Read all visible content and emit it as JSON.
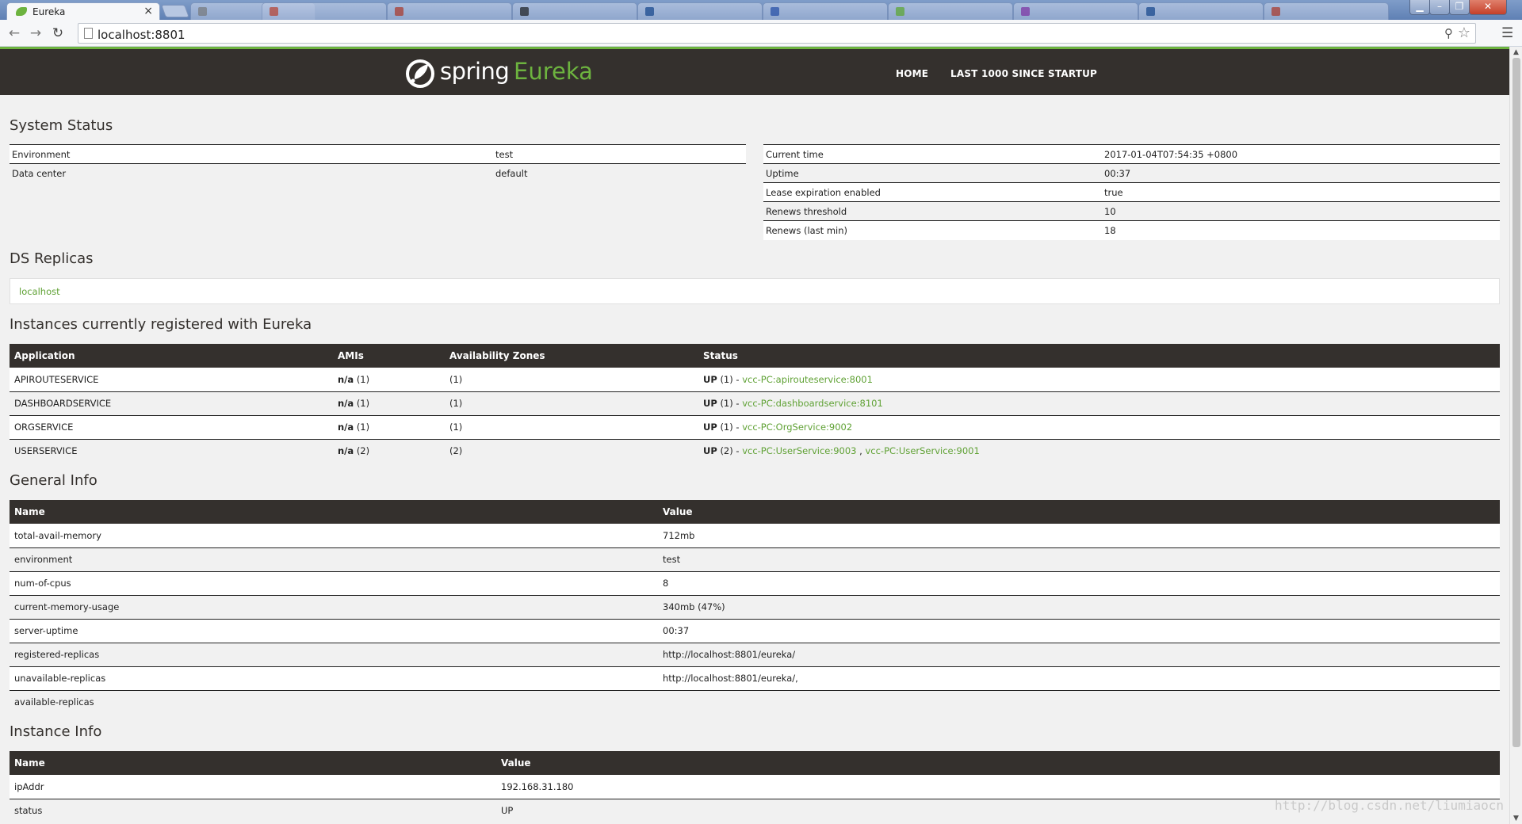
{
  "browser": {
    "tab_title": "Eureka",
    "tab_close": "×",
    "url": "localhost:8801"
  },
  "navbar": {
    "brand_spring": "spring",
    "brand_eureka": "Eureka",
    "links": [
      "HOME",
      "LAST 1000 SINCE STARTUP"
    ]
  },
  "system_status": {
    "heading": "System Status",
    "left": [
      {
        "key": "Environment",
        "value": "test"
      },
      {
        "key": "Data center",
        "value": "default"
      }
    ],
    "right": [
      {
        "key": "Current time",
        "value": "2017-01-04T07:54:35 +0800"
      },
      {
        "key": "Uptime",
        "value": "00:37"
      },
      {
        "key": "Lease expiration enabled",
        "value": "true"
      },
      {
        "key": "Renews threshold",
        "value": "10"
      },
      {
        "key": "Renews (last min)",
        "value": "18"
      }
    ]
  },
  "ds_replicas": {
    "heading": "DS Replicas",
    "replica": "localhost"
  },
  "instances": {
    "heading": "Instances currently registered with Eureka",
    "columns": [
      "Application",
      "AMIs",
      "Availability Zones",
      "Status"
    ],
    "rows": [
      {
        "application": "APIROUTESERVICE",
        "ami_label": "n/a",
        "ami_count": "(1)",
        "zones": "(1)",
        "status": "UP",
        "status_count": "(1) -",
        "links": [
          "vcc-PC:apirouteservice:8001"
        ]
      },
      {
        "application": "DASHBOARDSERVICE",
        "ami_label": "n/a",
        "ami_count": "(1)",
        "zones": "(1)",
        "status": "UP",
        "status_count": "(1) -",
        "links": [
          "vcc-PC:dashboardservice:8101"
        ]
      },
      {
        "application": "ORGSERVICE",
        "ami_label": "n/a",
        "ami_count": "(1)",
        "zones": "(1)",
        "status": "UP",
        "status_count": "(1) -",
        "links": [
          "vcc-PC:OrgService:9002"
        ]
      },
      {
        "application": "USERSERVICE",
        "ami_label": "n/a",
        "ami_count": "(2)",
        "zones": "(2)",
        "status": "UP",
        "status_count": "(2) -",
        "links": [
          "vcc-PC:UserService:9003",
          "vcc-PC:UserService:9001"
        ]
      }
    ],
    "link_separator": " , "
  },
  "general_info": {
    "heading": "General Info",
    "columns": [
      "Name",
      "Value"
    ],
    "rows": [
      {
        "name": "total-avail-memory",
        "value": "712mb"
      },
      {
        "name": "environment",
        "value": "test"
      },
      {
        "name": "num-of-cpus",
        "value": "8"
      },
      {
        "name": "current-memory-usage",
        "value": "340mb (47%)"
      },
      {
        "name": "server-uptime",
        "value": "00:37"
      },
      {
        "name": "registered-replicas",
        "value": "http://localhost:8801/eureka/"
      },
      {
        "name": "unavailable-replicas",
        "value": "http://localhost:8801/eureka/,"
      },
      {
        "name": "available-replicas",
        "value": ""
      }
    ]
  },
  "instance_info": {
    "heading": "Instance Info",
    "columns": [
      "Name",
      "Value"
    ],
    "rows": [
      {
        "name": "ipAddr",
        "value": "192.168.31.180"
      },
      {
        "name": "status",
        "value": "UP"
      }
    ]
  },
  "watermark": "http://blog.csdn.net/liumiaocn",
  "colors": {
    "brand_green": "#6db33f",
    "link_green": "#5fa134",
    "navbar_dark": "#34302d",
    "page_bg": "#f1f1f1"
  }
}
